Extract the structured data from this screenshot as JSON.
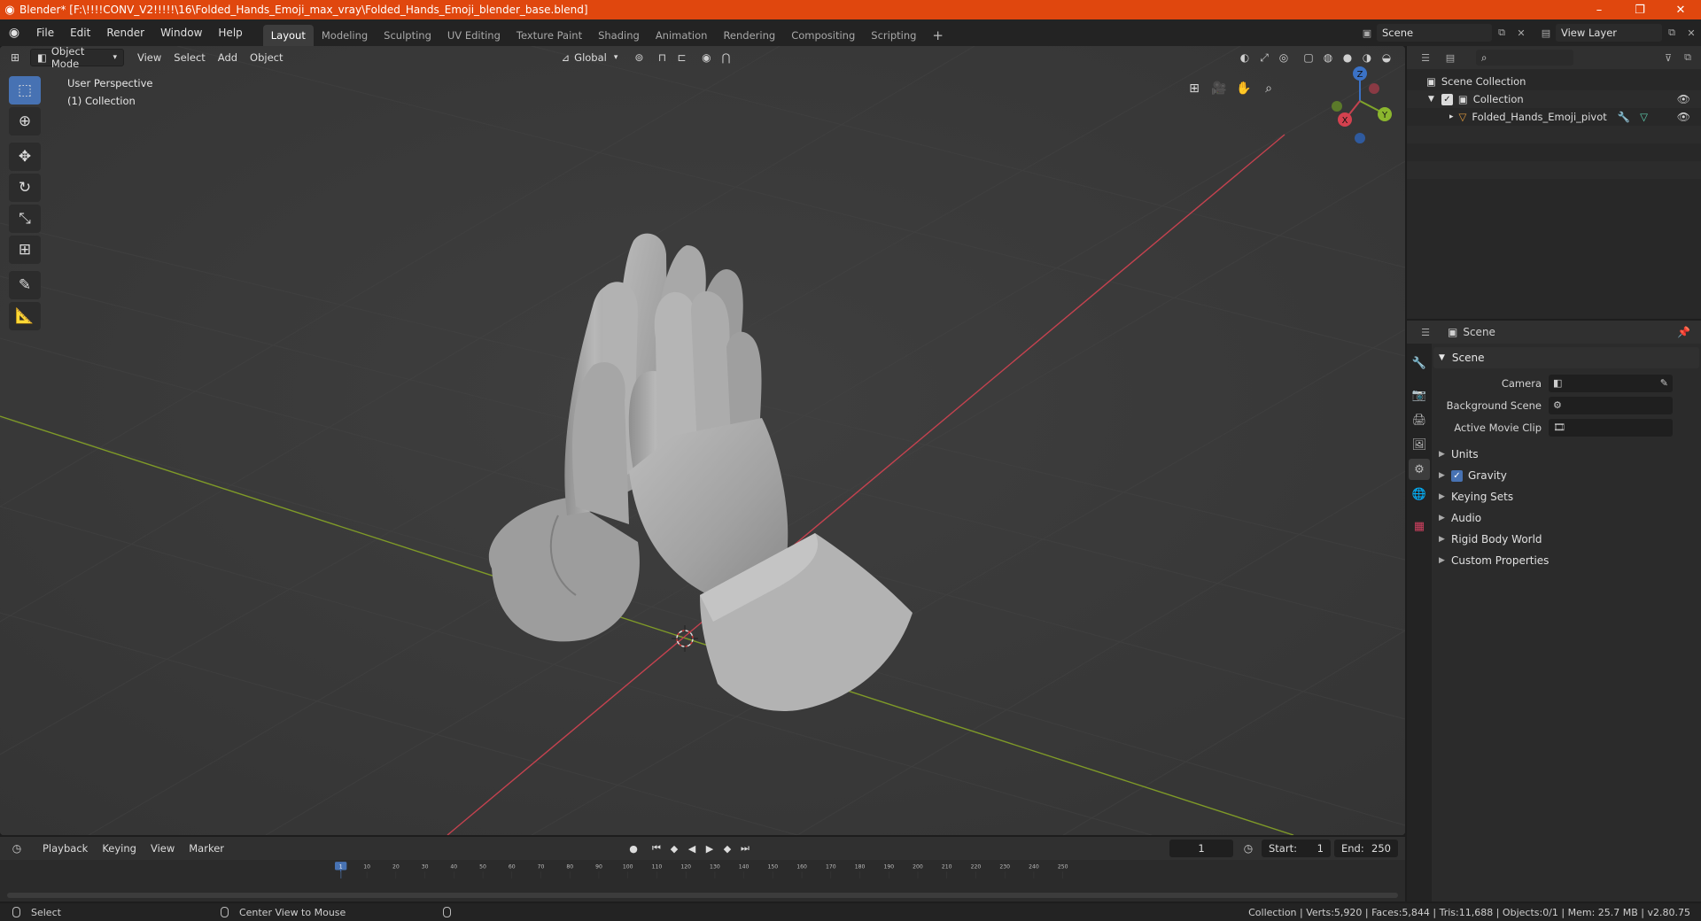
{
  "window": {
    "title": "Blender* [F:\\!!!!CONV_V2!!!!!\\16\\Folded_Hands_Emoji_max_vray\\Folded_Hands_Emoji_blender_base.blend]",
    "minimize": "–",
    "maximize": "❐",
    "close": "✕"
  },
  "menu": [
    "File",
    "Edit",
    "Render",
    "Window",
    "Help"
  ],
  "workspaces": [
    "Layout",
    "Modeling",
    "Sculpting",
    "UV Editing",
    "Texture Paint",
    "Shading",
    "Animation",
    "Rendering",
    "Compositing",
    "Scripting"
  ],
  "active_workspace": "Layout",
  "scene_field": "Scene",
  "view_layer_field": "View Layer",
  "viewport": {
    "mode": "Object Mode",
    "menus": [
      "View",
      "Select",
      "Add",
      "Object"
    ],
    "transform_orientation": "Global",
    "perspective_label": "User Perspective",
    "collection_label": "(1) Collection",
    "gizmo_axes": {
      "x": "X",
      "y": "Y",
      "z": "Z"
    },
    "colors": {
      "background": "#393939",
      "x_axis": "#c4424f",
      "y_axis": "#7f9a28",
      "active_tool": "#4772b3"
    }
  },
  "outliner": {
    "root": "Scene Collection",
    "collection": "Collection",
    "object": "Folded_Hands_Emoji_pivot"
  },
  "properties": {
    "header": "Scene",
    "panel": "Scene",
    "camera_label": "Camera",
    "background_scene_label": "Background Scene",
    "active_movie_clip_label": "Active Movie Clip",
    "subpanels": [
      "Units",
      "Gravity",
      "Keying Sets",
      "Audio",
      "Rigid Body World",
      "Custom Properties"
    ],
    "gravity_checked": true
  },
  "timeline": {
    "menus": [
      "Playback",
      "Keying",
      "View",
      "Marker"
    ],
    "current_frame": "1",
    "start_label": "Start:",
    "start": "1",
    "end_label": "End:",
    "end": "250",
    "ticks": [
      "1",
      "10",
      "20",
      "30",
      "40",
      "50",
      "60",
      "70",
      "80",
      "90",
      "100",
      "110",
      "120",
      "130",
      "140",
      "150",
      "160",
      "170",
      "180",
      "190",
      "200",
      "210",
      "220",
      "230",
      "240",
      "250"
    ]
  },
  "statusbar": {
    "select": "Select",
    "center_view": "Center View to Mouse",
    "stats": "Collection | Verts:5,920 | Faces:5,844 | Tris:11,688 | Objects:0/1 | Mem: 25.7 MB | v2.80.75"
  }
}
